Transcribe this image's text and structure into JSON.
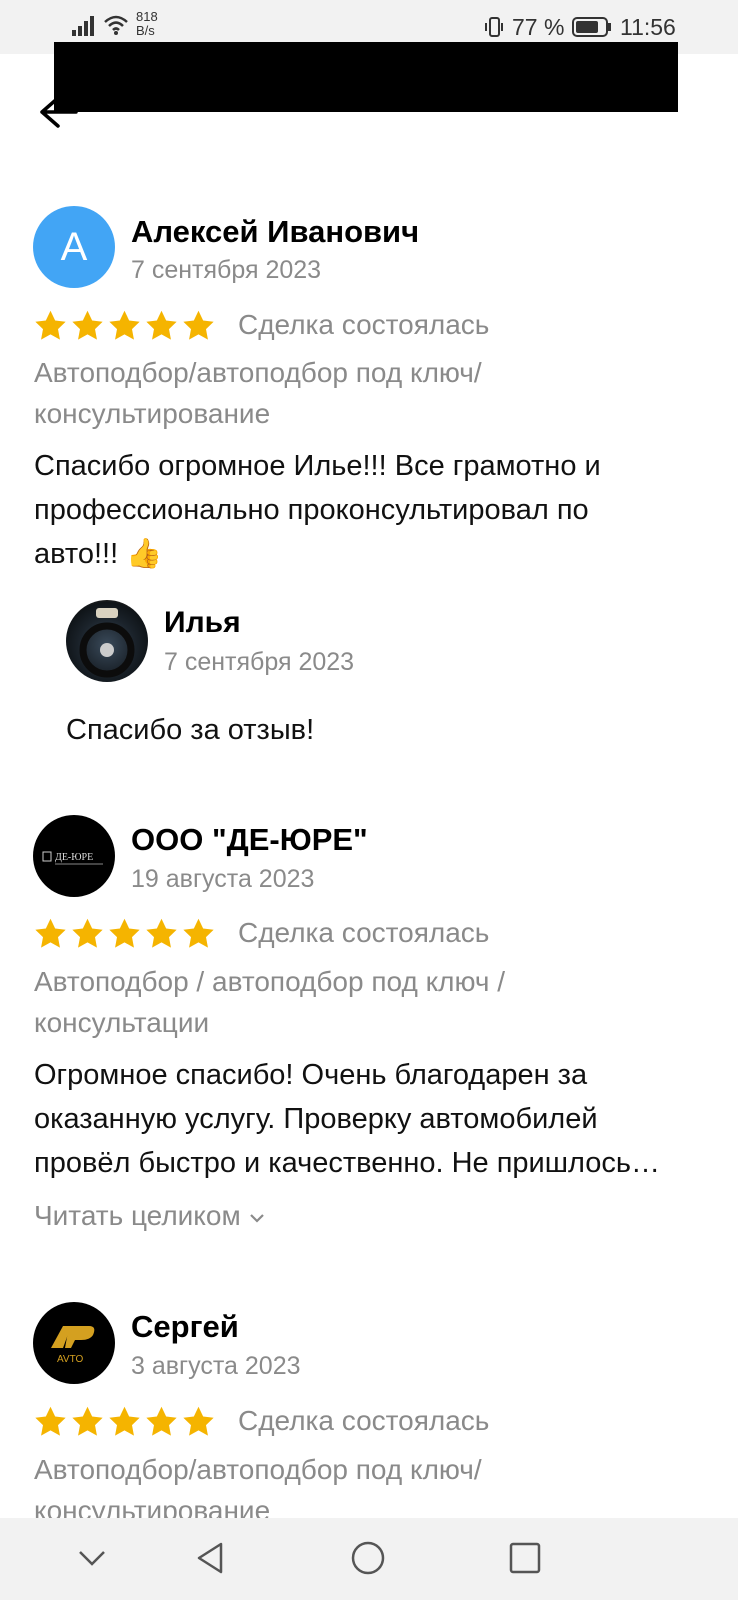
{
  "status_bar": {
    "speed_value": "818",
    "speed_unit": "B/s",
    "battery": "77 %",
    "time": "11:56"
  },
  "reviews": [
    {
      "avatar_letter": "А",
      "author": "Алексей Иванович",
      "date": "7 сентября 2023",
      "rating": 5,
      "deal": "Сделка состоялась",
      "category_line1": "Автоподбор/автоподбор под ключ/",
      "category_line2": "консультирование",
      "text_line1": "Спасибо огромное Илье!!! Все грамотно и",
      "text_line2": "профессионально проконсультировал по",
      "text_line3": "авто!!! 👍",
      "reply": {
        "author": "Илья",
        "date": "7 сентября 2023",
        "text": "Спасибо за отзыв!"
      }
    },
    {
      "author": "ООО \"ДЕ-ЮРЕ\"",
      "avatar_logo_text": "ДЕ-ЮРЕ",
      "date": "19 августа 2023",
      "rating": 5,
      "deal": "Сделка состоялась",
      "category_line1": "Автоподбор / автоподбор под ключ /",
      "category_line2": "консультации",
      "text_line1": "Огромное спасибо! Очень благодарен за",
      "text_line2": "оказанную услугу. Проверку автомобилей",
      "text_line3": "провёл быстро и качественно. Не пришлось…",
      "read_more": "Читать целиком"
    },
    {
      "author": "Сергей",
      "avatar_logo_text": "AVTO",
      "date": "3 августа 2023",
      "rating": 5,
      "deal": "Сделка состоялась",
      "category_line1": "Автоподбор/автоподбор под ключ/",
      "category_line2": "консультирование"
    }
  ],
  "colors": {
    "star": "#f5b400",
    "avatar_blue": "#42a5f5",
    "muted_text": "#8a8a8a"
  }
}
